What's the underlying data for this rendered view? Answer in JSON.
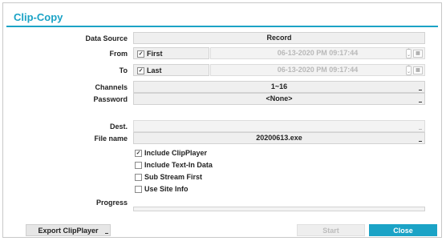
{
  "dialog": {
    "title": "Clip-Copy"
  },
  "data_source": {
    "label": "Data Source",
    "value": "Record"
  },
  "from": {
    "label": "From",
    "checkbox_label": "First",
    "checked": true,
    "datetime": "06-13-2020  PM 09:17:44"
  },
  "to": {
    "label": "To",
    "checkbox_label": "Last",
    "checked": true,
    "datetime": "06-13-2020  PM 09:17:44"
  },
  "channels": {
    "label": "Channels",
    "value": "1~16"
  },
  "password": {
    "label": "Password",
    "value": "<None>"
  },
  "dest": {
    "label": "Dest.",
    "value": ""
  },
  "file_name": {
    "label": "File name",
    "value": "20200613.exe"
  },
  "options": [
    {
      "label": "Include ClipPlayer",
      "checked": true
    },
    {
      "label": "Include Text-In Data",
      "checked": false
    },
    {
      "label": "Sub Stream First",
      "checked": false
    },
    {
      "label": "Use Site Info",
      "checked": false
    }
  ],
  "progress": {
    "label": "Progress",
    "value": 0
  },
  "buttons": {
    "export_label": "Export ClipPlayer",
    "start_label": "Start",
    "close_label": "Close"
  },
  "colors": {
    "accent": "#1ba3c6",
    "field_bg": "#efefef",
    "disabled_text": "#b8b8b8"
  }
}
